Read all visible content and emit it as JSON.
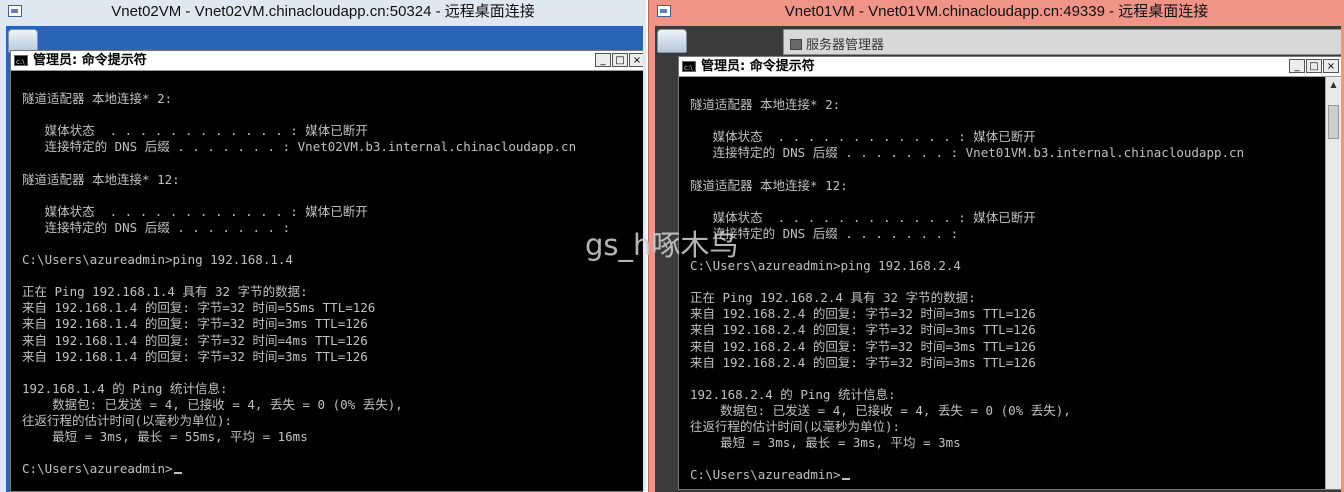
{
  "left_window": {
    "title": "Vnet02VM - Vnet02VM.chinacloudapp.cn:50324 - 远程桌面连接",
    "cmd_title": "管理员: 命令提示符",
    "console_lines": [
      "隧道适配器 本地连接* 2:",
      "",
      "   媒体状态  . . . . . . . . . . . . : 媒体已断开",
      "   连接特定的 DNS 后缀 . . . . . . . : Vnet02VM.b3.internal.chinacloudapp.cn",
      "",
      "隧道适配器 本地连接* 12:",
      "",
      "   媒体状态  . . . . . . . . . . . . : 媒体已断开",
      "   连接特定的 DNS 后缀 . . . . . . . :",
      "",
      "C:\\Users\\azureadmin>ping 192.168.1.4",
      "",
      "正在 Ping 192.168.1.4 具有 32 字节的数据:",
      "来自 192.168.1.4 的回复: 字节=32 时间=55ms TTL=126",
      "来自 192.168.1.4 的回复: 字节=32 时间=3ms TTL=126",
      "来自 192.168.1.4 的回复: 字节=32 时间=4ms TTL=126",
      "来自 192.168.1.4 的回复: 字节=32 时间=3ms TTL=126",
      "",
      "192.168.1.4 的 Ping 统计信息:",
      "    数据包: 已发送 = 4, 已接收 = 4, 丢失 = 0 (0% 丢失),",
      "往返行程的估计时间(以毫秒为单位):",
      "    最短 = 3ms, 最长 = 55ms, 平均 = 16ms",
      "",
      "C:\\Users\\azureadmin>"
    ]
  },
  "right_window": {
    "title": "Vnet01VM - Vnet01VM.chinacloudapp.cn:49339 - 远程桌面连接",
    "server_manager_title": "服务器管理器",
    "cmd_title": "管理员: 命令提示符",
    "console_lines": [
      "隧道适配器 本地连接* 2:",
      "",
      "   媒体状态  . . . . . . . . . . . . : 媒体已断开",
      "   连接特定的 DNS 后缀 . . . . . . . : Vnet01VM.b3.internal.chinacloudapp.cn",
      "",
      "隧道适配器 本地连接* 12:",
      "",
      "   媒体状态  . . . . . . . . . . . . : 媒体已断开",
      "   连接特定的 DNS 后缀 . . . . . . . :",
      "",
      "C:\\Users\\azureadmin>ping 192.168.2.4",
      "",
      "正在 Ping 192.168.2.4 具有 32 字节的数据:",
      "来自 192.168.2.4 的回复: 字节=32 时间=3ms TTL=126",
      "来自 192.168.2.4 的回复: 字节=32 时间=3ms TTL=126",
      "来自 192.168.2.4 的回复: 字节=32 时间=3ms TTL=126",
      "来自 192.168.2.4 的回复: 字节=32 时间=3ms TTL=126",
      "",
      "192.168.2.4 的 Ping 统计信息:",
      "    数据包: 已发送 = 4, 已接收 = 4, 丢失 = 0 (0% 丢失),",
      "往返行程的估计时间(以毫秒为单位):",
      "    最短 = 3ms, 最长 = 3ms, 平均 = 3ms",
      "",
      "C:\\Users\\azureadmin>"
    ]
  },
  "watermark": "gs_h啄木鸟",
  "icons": {
    "window_buttons": [
      "_",
      "□",
      "×"
    ],
    "scroll_up": "▲"
  },
  "colors": {
    "left_frame": "#dfe7f1",
    "right_frame": "#f09488",
    "console_bg": "#000000",
    "console_text": "#c0c0c0"
  }
}
